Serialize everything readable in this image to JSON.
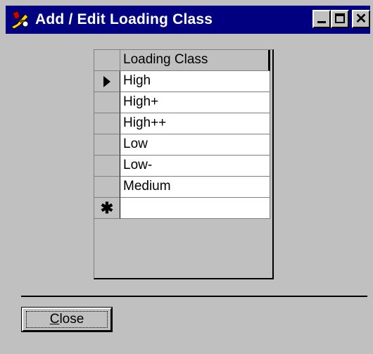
{
  "window": {
    "title": "Add / Edit Loading Class",
    "buttons": {
      "minimize": "_",
      "maximize": "□",
      "close": "×"
    }
  },
  "grid": {
    "column_header": "Loading Class",
    "rows": [
      {
        "value": "High",
        "current": true
      },
      {
        "value": "High+",
        "current": false
      },
      {
        "value": "High++",
        "current": false
      },
      {
        "value": "Low",
        "current": false
      },
      {
        "value": "Low-",
        "current": false
      },
      {
        "value": "Medium",
        "current": false
      }
    ],
    "new_row_marker": "✱"
  },
  "footer": {
    "close_label_prefix": "C",
    "close_label_rest": "lose"
  }
}
